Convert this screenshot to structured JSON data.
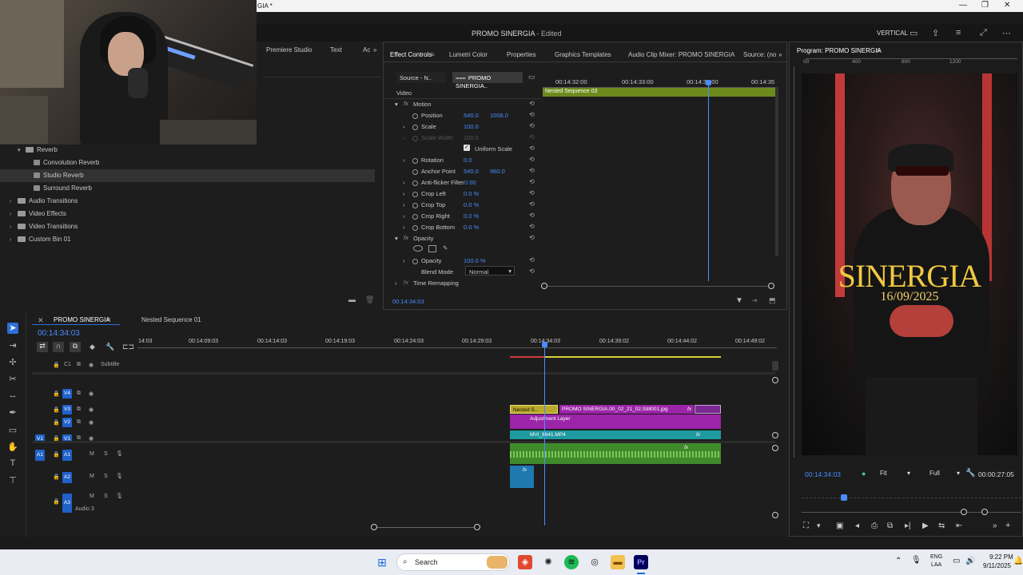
{
  "window": {
    "title_partial": "GIA *",
    "minimize": "—",
    "maximize": "❐",
    "close": "✕"
  },
  "menubar": {
    "project_title": "PROMO SINERGIA",
    "status": "- Edited",
    "workspace": "VERTICAL"
  },
  "left_panel": {
    "tabs": [
      "Premiere Studio",
      "Text",
      "Ac"
    ],
    "tree": [
      {
        "label": "Reverb",
        "type": "folder",
        "level": 1,
        "open": true
      },
      {
        "label": "Convolution Reverb",
        "type": "effect",
        "level": 2
      },
      {
        "label": "Studio Reverb",
        "type": "effect",
        "level": 2,
        "selected": true
      },
      {
        "label": "Surround Reverb",
        "type": "effect",
        "level": 2
      },
      {
        "label": "Audio Transitions",
        "type": "folder",
        "level": 0
      },
      {
        "label": "Video Effects",
        "type": "folder",
        "level": 0
      },
      {
        "label": "Video Transitions",
        "type": "folder",
        "level": 0
      },
      {
        "label": "Custom Bin 01",
        "type": "folder",
        "level": 0
      }
    ]
  },
  "effect_controls": {
    "tabs": [
      "Effect Controls",
      "Lumetri Color",
      "Properties",
      "Graphics Templates",
      "Audio Clip Mixer: PROMO SINERGIA",
      "Source: (no"
    ],
    "source_label": "Source - N..",
    "sequence_label": "PROMO SINERGIA..",
    "ruler": [
      "00:14:32:00",
      "00:14:33:00",
      "00:14:34:00",
      "00:14:35"
    ],
    "nested_clip": "Nested Sequence 03",
    "section_video": "Video",
    "motion": "Motion",
    "position": {
      "label": "Position",
      "x": "540.0",
      "y": "1008.0"
    },
    "scale": {
      "label": "Scale",
      "value": "100.0"
    },
    "scale_width": {
      "label": "Scale Width",
      "value": "100.0"
    },
    "uniform_scale": "Uniform Scale",
    "rotation": {
      "label": "Rotation",
      "value": "0.0"
    },
    "anchor": {
      "label": "Anchor Point",
      "x": "540.0",
      "y": "960.0"
    },
    "antiflicker": {
      "label": "Anti-flicker Filter",
      "value": "0.00"
    },
    "crop_left": {
      "label": "Crop Left",
      "value": "0.0 %"
    },
    "crop_top": {
      "label": "Crop Top",
      "value": "0.0 %"
    },
    "crop_right": {
      "label": "Crop Right",
      "value": "0.0 %"
    },
    "crop_bottom": {
      "label": "Crop Bottom",
      "value": "0.0 %"
    },
    "opacity_section": "Opacity",
    "opacity": {
      "label": "Opacity",
      "value": "100.0 %"
    },
    "blend": {
      "label": "Blend Mode",
      "value": "Normal"
    },
    "time_remap": "Time Remapping",
    "timecode": "00:14:34:03"
  },
  "program": {
    "title": "Program: PROMO SINERGIA",
    "ruler": [
      "00",
      "400",
      "800",
      "1200"
    ],
    "title_text": "SINERGIA",
    "date_text": "16/09/2025",
    "timecode": "00:14:34:03",
    "fit": "Fit",
    "quality": "Full",
    "duration": "00:00:27:05"
  },
  "timeline": {
    "tabs": [
      "PROMO SINERGIA",
      "Nested Sequence 01"
    ],
    "timecode": "00:14:34:03",
    "ruler": [
      "14:03",
      "00:14:09:03",
      "00:14:14:03",
      "00:14:19:03",
      "00:14:24:03",
      "00:14:29:03",
      "00:14:34:03",
      "00:14:39:02",
      "00:14:44:02",
      "00:14:49:02"
    ],
    "tracks": {
      "subtitle": "Subtitle",
      "c1": "C1",
      "v4": "V4",
      "v3": "V3",
      "v2": "V2",
      "v1": "V1",
      "a1": "A1",
      "a2": "A2",
      "a3": "A3",
      "audio3": "Audio 3",
      "m": "M",
      "s": "S"
    },
    "clips": {
      "nested": "Nested S..",
      "still": "PROMO SINERGIA.00_02_21_02.Still001.jpg",
      "adjust": "Adjustment Layer",
      "mvi": "MVI_6641.MP4",
      "fx": "fx"
    }
  },
  "taskbar": {
    "search": "Search",
    "lang_top": "ENG",
    "lang_bottom": "LAA",
    "time": "9:22 PM",
    "date": "9/11/2025"
  },
  "colors": {
    "accent": "#2d6fd8",
    "nested": "#b9a92a",
    "purple": "#9b25a8",
    "teal": "#1f9aa0",
    "audio": "#3f8a2a",
    "title": "#f0c842"
  }
}
